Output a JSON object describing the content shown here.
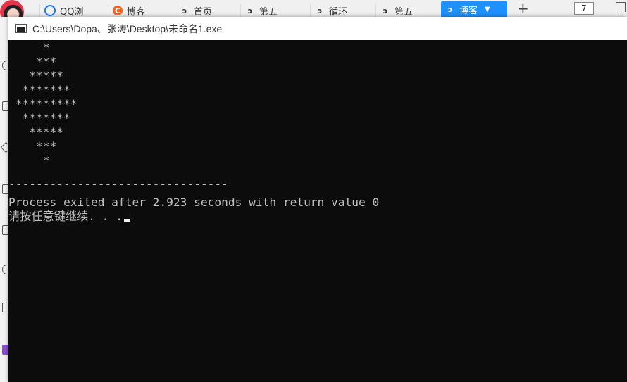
{
  "browser": {
    "tabs": [
      {
        "label": "QQ浏",
        "icon": "qq-browser-icon",
        "icon_color": "#1677ff"
      },
      {
        "label": "博客",
        "icon": "csdn-blog-icon",
        "icon_color": "#f26522"
      },
      {
        "label": "首页",
        "icon": "paw-icon"
      },
      {
        "label": "第五",
        "icon": "paw-icon"
      },
      {
        "label": "循环",
        "icon": "paw-icon"
      },
      {
        "label": "第五",
        "icon": "paw-icon"
      },
      {
        "label": "博客",
        "icon": "paw-icon",
        "active": true
      }
    ],
    "new_tab_label": "+",
    "tab_count": "7",
    "active_tab_color": "#1e90ff"
  },
  "console": {
    "title": "C:\\Users\\Dopa、张涛\\Desktop\\未命名1.exe",
    "background_color": "#0c0c0c",
    "text_color": "#c0c0c0",
    "lines": [
      "     *",
      "    ***",
      "   *****",
      "  *******",
      " *********",
      "  *******",
      "   *****",
      "    ***",
      "     *",
      "",
      "--------------------------------",
      "Process exited after 2.923 seconds with return value 0",
      "请按任意键继续. . ."
    ]
  }
}
